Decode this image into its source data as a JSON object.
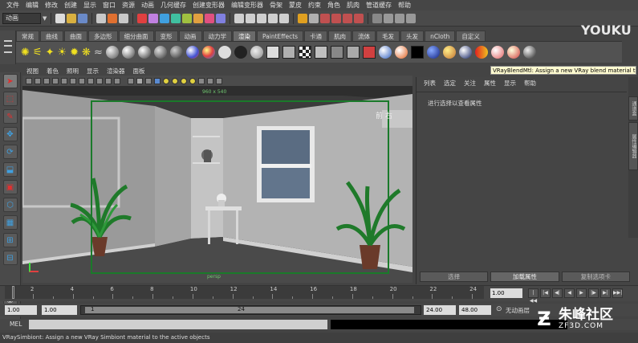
{
  "menu": [
    "文件",
    "编辑",
    "修改",
    "创建",
    "显示",
    "窗口",
    "资源",
    "动画",
    "几何缓存",
    "创建变形器",
    "编辑变形器",
    "骨架",
    "蒙皮",
    "约束",
    "角色",
    "肌肉",
    "管道缓存",
    "帮助"
  ],
  "mode_selector": "动画",
  "shelf_tabs": [
    "常规",
    "曲线",
    "曲面",
    "多边形",
    "细分曲面",
    "变形",
    "动画",
    "动力学",
    "渲染",
    "PaintEffects",
    "卡通",
    "肌肉",
    "流体",
    "毛发",
    "头发",
    "nCloth",
    "自定义"
  ],
  "active_shelf_tab": "渲染",
  "tooltip": "VRayBlendMtl: Assign a new VRay blend material to",
  "viewport": {
    "menu": [
      "视图",
      "着色",
      "照明",
      "显示",
      "渲染器",
      "面板"
    ],
    "resolution_label": "960 x 540",
    "camera_label": "persp",
    "corner_sign": "前 右"
  },
  "attribute_editor": {
    "menu": [
      "列表",
      "选定",
      "关注",
      "属性",
      "显示",
      "帮助"
    ],
    "message": "进行选择以查看属性",
    "buttons": [
      "选择",
      "加载属性",
      "复制选项卡"
    ]
  },
  "right_tabs": [
    "通道盒",
    "属性编辑器"
  ],
  "timeline": {
    "ticks": [
      "2",
      "4",
      "6",
      "8",
      "10",
      "12",
      "14",
      "16",
      "18",
      "20",
      "22",
      "24"
    ],
    "current_frame": "1.00"
  },
  "range": {
    "start": "1.00",
    "playback_start": "1.00",
    "slider_start": "1",
    "slider_end": "24",
    "playback_end": "24.00",
    "end": "48.00",
    "anim_layer": "无动画层"
  },
  "command": {
    "label": "MEL"
  },
  "help_line": "VRaySimbiont: Assign a new VRay Simbiont material to the active objects",
  "watermarks": {
    "youku": "YOUKU 优酷",
    "zf_cn": "朱峰社区",
    "zf_en": "ZF3D.COM"
  }
}
